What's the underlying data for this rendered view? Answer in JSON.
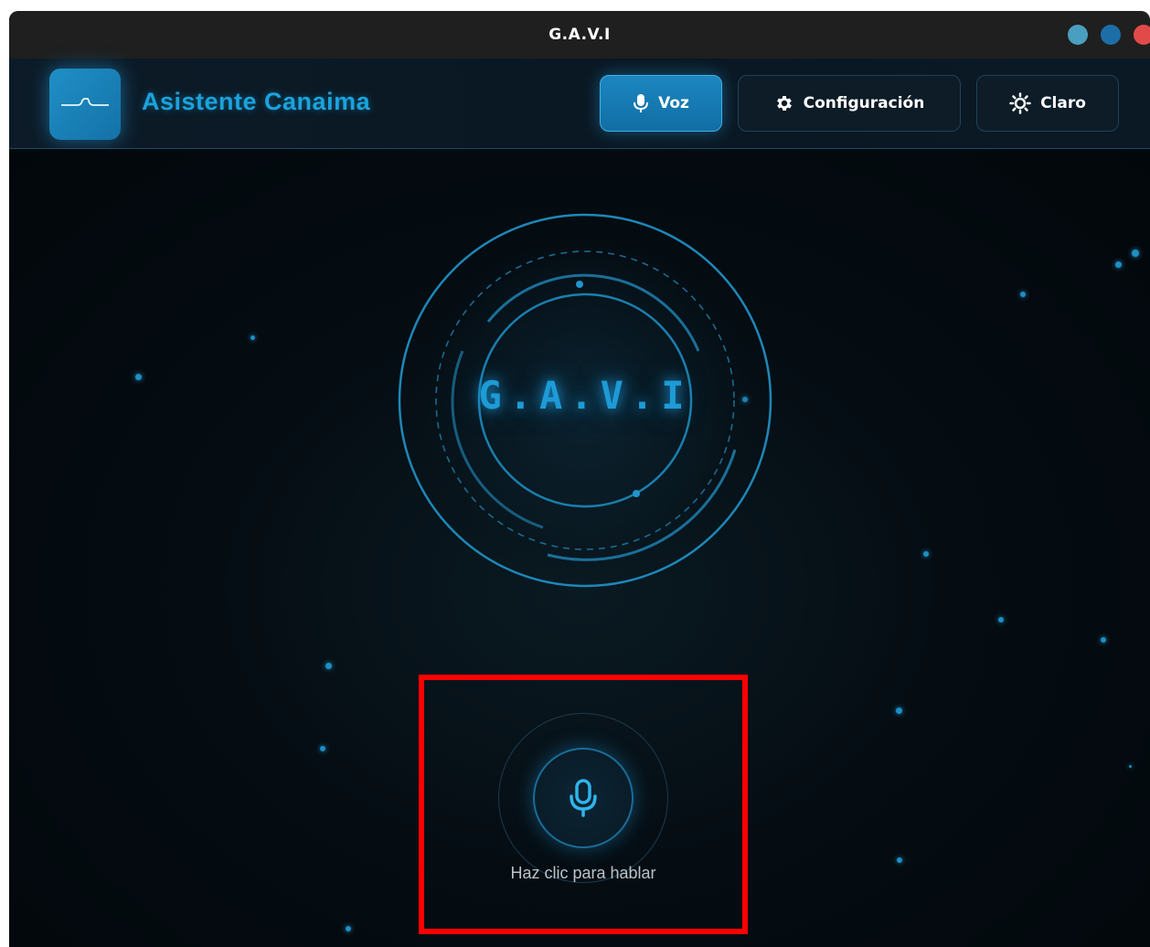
{
  "window": {
    "title": "G.A.V.I"
  },
  "header": {
    "app_name": "Asistente Canaima",
    "buttons": {
      "voice": "Voz",
      "settings": "Configuración",
      "theme": "Claro"
    }
  },
  "main": {
    "orb_text": "G.A.V.I",
    "mic_label": "Haz clic para hablar"
  },
  "colors": {
    "accent": "#1aa3dd",
    "background": "#03080c",
    "highlight": "#ff0000"
  },
  "icons": {
    "logo": "waveform-icon",
    "voice": "microphone-icon",
    "settings": "gear-icon",
    "theme": "sun-icon",
    "mic": "microphone-icon"
  }
}
